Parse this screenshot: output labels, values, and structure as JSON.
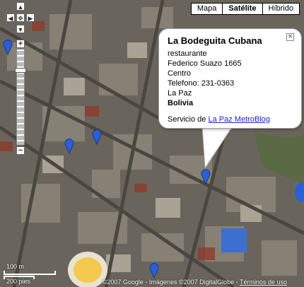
{
  "map_types": {
    "map": "Mapa",
    "satellite": "Satélite",
    "hybrid": "Híbrido",
    "active": "Satélite"
  },
  "controls": {
    "zoom_in": "+",
    "zoom_out": "−"
  },
  "info_window": {
    "title": "La Bodeguita Cubana",
    "lines": [
      "restaurante",
      "Federico Suazo 1665",
      "Centro",
      "Telefono: 231-0363",
      "La Paz"
    ],
    "country": "Bolivia",
    "service_prefix": "Servicio de",
    "service_link": "La Paz MetroBlog"
  },
  "scale": {
    "top": "100 m",
    "bottom": "200 pies"
  },
  "footer": {
    "attribution": "©2007 Google - Imágenes ©2007 DigitalGlobe -",
    "terms": "Términos de uso"
  },
  "colors": {
    "marker": "#2b5fd6",
    "link": "#2020cc",
    "stadium": "#f2c94c"
  }
}
